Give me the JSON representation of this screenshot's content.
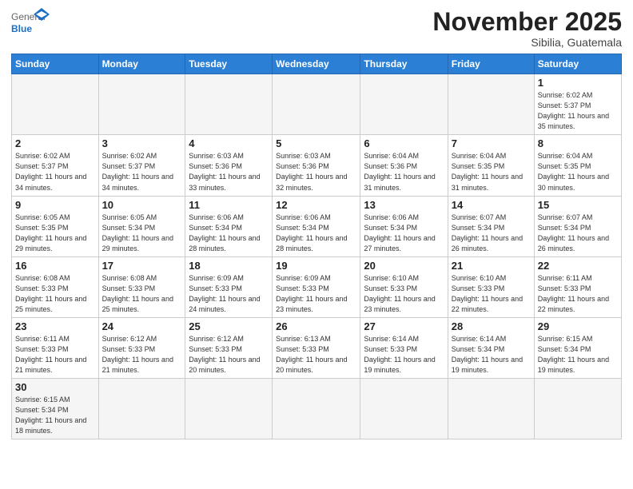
{
  "header": {
    "logo_general": "General",
    "logo_blue": "Blue",
    "month_title": "November 2025",
    "subtitle": "Sibilia, Guatemala"
  },
  "weekdays": [
    "Sunday",
    "Monday",
    "Tuesday",
    "Wednesday",
    "Thursday",
    "Friday",
    "Saturday"
  ],
  "days": [
    {
      "num": "",
      "info": ""
    },
    {
      "num": "",
      "info": ""
    },
    {
      "num": "",
      "info": ""
    },
    {
      "num": "",
      "info": ""
    },
    {
      "num": "",
      "info": ""
    },
    {
      "num": "",
      "info": ""
    },
    {
      "num": "1",
      "info": "Sunrise: 6:02 AM\nSunset: 5:37 PM\nDaylight: 11 hours\nand 35 minutes."
    },
    {
      "num": "2",
      "info": "Sunrise: 6:02 AM\nSunset: 5:37 PM\nDaylight: 11 hours\nand 34 minutes."
    },
    {
      "num": "3",
      "info": "Sunrise: 6:02 AM\nSunset: 5:37 PM\nDaylight: 11 hours\nand 34 minutes."
    },
    {
      "num": "4",
      "info": "Sunrise: 6:03 AM\nSunset: 5:36 PM\nDaylight: 11 hours\nand 33 minutes."
    },
    {
      "num": "5",
      "info": "Sunrise: 6:03 AM\nSunset: 5:36 PM\nDaylight: 11 hours\nand 32 minutes."
    },
    {
      "num": "6",
      "info": "Sunrise: 6:04 AM\nSunset: 5:36 PM\nDaylight: 11 hours\nand 31 minutes."
    },
    {
      "num": "7",
      "info": "Sunrise: 6:04 AM\nSunset: 5:35 PM\nDaylight: 11 hours\nand 31 minutes."
    },
    {
      "num": "8",
      "info": "Sunrise: 6:04 AM\nSunset: 5:35 PM\nDaylight: 11 hours\nand 30 minutes."
    },
    {
      "num": "9",
      "info": "Sunrise: 6:05 AM\nSunset: 5:35 PM\nDaylight: 11 hours\nand 29 minutes."
    },
    {
      "num": "10",
      "info": "Sunrise: 6:05 AM\nSunset: 5:34 PM\nDaylight: 11 hours\nand 29 minutes."
    },
    {
      "num": "11",
      "info": "Sunrise: 6:06 AM\nSunset: 5:34 PM\nDaylight: 11 hours\nand 28 minutes."
    },
    {
      "num": "12",
      "info": "Sunrise: 6:06 AM\nSunset: 5:34 PM\nDaylight: 11 hours\nand 28 minutes."
    },
    {
      "num": "13",
      "info": "Sunrise: 6:06 AM\nSunset: 5:34 PM\nDaylight: 11 hours\nand 27 minutes."
    },
    {
      "num": "14",
      "info": "Sunrise: 6:07 AM\nSunset: 5:34 PM\nDaylight: 11 hours\nand 26 minutes."
    },
    {
      "num": "15",
      "info": "Sunrise: 6:07 AM\nSunset: 5:34 PM\nDaylight: 11 hours\nand 26 minutes."
    },
    {
      "num": "16",
      "info": "Sunrise: 6:08 AM\nSunset: 5:33 PM\nDaylight: 11 hours\nand 25 minutes."
    },
    {
      "num": "17",
      "info": "Sunrise: 6:08 AM\nSunset: 5:33 PM\nDaylight: 11 hours\nand 25 minutes."
    },
    {
      "num": "18",
      "info": "Sunrise: 6:09 AM\nSunset: 5:33 PM\nDaylight: 11 hours\nand 24 minutes."
    },
    {
      "num": "19",
      "info": "Sunrise: 6:09 AM\nSunset: 5:33 PM\nDaylight: 11 hours\nand 23 minutes."
    },
    {
      "num": "20",
      "info": "Sunrise: 6:10 AM\nSunset: 5:33 PM\nDaylight: 11 hours\nand 23 minutes."
    },
    {
      "num": "21",
      "info": "Sunrise: 6:10 AM\nSunset: 5:33 PM\nDaylight: 11 hours\nand 22 minutes."
    },
    {
      "num": "22",
      "info": "Sunrise: 6:11 AM\nSunset: 5:33 PM\nDaylight: 11 hours\nand 22 minutes."
    },
    {
      "num": "23",
      "info": "Sunrise: 6:11 AM\nSunset: 5:33 PM\nDaylight: 11 hours\nand 21 minutes."
    },
    {
      "num": "24",
      "info": "Sunrise: 6:12 AM\nSunset: 5:33 PM\nDaylight: 11 hours\nand 21 minutes."
    },
    {
      "num": "25",
      "info": "Sunrise: 6:12 AM\nSunset: 5:33 PM\nDaylight: 11 hours\nand 20 minutes."
    },
    {
      "num": "26",
      "info": "Sunrise: 6:13 AM\nSunset: 5:33 PM\nDaylight: 11 hours\nand 20 minutes."
    },
    {
      "num": "27",
      "info": "Sunrise: 6:14 AM\nSunset: 5:33 PM\nDaylight: 11 hours\nand 19 minutes."
    },
    {
      "num": "28",
      "info": "Sunrise: 6:14 AM\nSunset: 5:34 PM\nDaylight: 11 hours\nand 19 minutes."
    },
    {
      "num": "29",
      "info": "Sunrise: 6:15 AM\nSunset: 5:34 PM\nDaylight: 11 hours\nand 19 minutes."
    },
    {
      "num": "30",
      "info": "Sunrise: 6:15 AM\nSunset: 5:34 PM\nDaylight: 11 hours\nand 18 minutes."
    },
    {
      "num": "",
      "info": ""
    },
    {
      "num": "",
      "info": ""
    },
    {
      "num": "",
      "info": ""
    },
    {
      "num": "",
      "info": ""
    },
    {
      "num": "",
      "info": ""
    },
    {
      "num": "",
      "info": ""
    }
  ]
}
